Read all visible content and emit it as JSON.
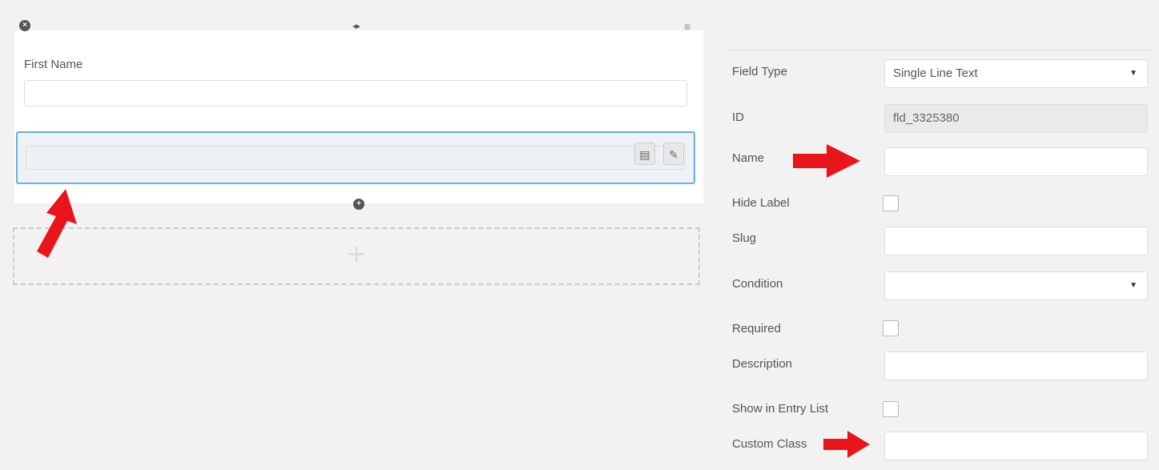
{
  "builder": {
    "row_controls": {
      "remove_icon": "x-circle-icon",
      "resize_icon": "resize-horizontal-icon",
      "menu_icon": "hamburger-icon"
    },
    "field": {
      "label": "First Name",
      "value": ""
    },
    "add_field_icon": "plus-circle-icon",
    "new_row_icon": "plus-icon"
  },
  "settings": {
    "field_type": {
      "label": "Field Type",
      "value": "Single Line Text"
    },
    "id": {
      "label": "ID",
      "value": "fld_3325380"
    },
    "name": {
      "label": "Name",
      "value": ""
    },
    "hide_label": {
      "label": "Hide Label",
      "checked": false
    },
    "slug": {
      "label": "Slug",
      "value": ""
    },
    "condition": {
      "label": "Condition",
      "value": ""
    },
    "required": {
      "label": "Required",
      "checked": false
    },
    "description": {
      "label": "Description",
      "value": ""
    },
    "show_in_entry_list": {
      "label": "Show in Entry List",
      "checked": false
    },
    "custom_class": {
      "label": "Custom Class",
      "value": ""
    }
  },
  "colors": {
    "arrow": "#e8161b",
    "focus_border": "#66afe9",
    "background": "#f2f2f2"
  }
}
